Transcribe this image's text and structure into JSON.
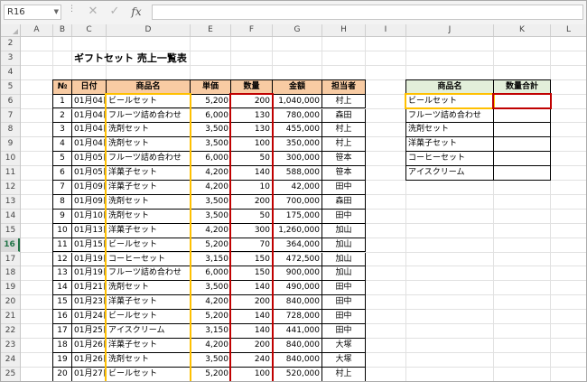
{
  "name_box": "R16",
  "formula_bar": {
    "fx_label": "fx",
    "cancel_icon": "✕",
    "enter_icon": "✓",
    "value": ""
  },
  "columns": [
    "A",
    "B",
    "C",
    "D",
    "E",
    "F",
    "G",
    "H",
    "I",
    "J",
    "K",
    "L"
  ],
  "rows": [
    2,
    3,
    4,
    5,
    6,
    7,
    8,
    9,
    10,
    11,
    12,
    13,
    14,
    15,
    16,
    17,
    18,
    19,
    20,
    21,
    22,
    23,
    24,
    25
  ],
  "active_row": 16,
  "title": "ギフトセット 売上一覧表",
  "sales_table": {
    "headers": [
      "№",
      "日付",
      "商品名",
      "単価",
      "数量",
      "金額",
      "担当者"
    ],
    "rows": [
      [
        "1",
        "01月04日",
        "ビールセット",
        "5,200",
        "200",
        "1,040,000",
        "村上"
      ],
      [
        "2",
        "01月04日",
        "フルーツ詰め合わせ",
        "6,000",
        "130",
        "780,000",
        "森田"
      ],
      [
        "3",
        "01月04日",
        "洗剤セット",
        "3,500",
        "130",
        "455,000",
        "村上"
      ],
      [
        "4",
        "01月04日",
        "洗剤セット",
        "3,500",
        "100",
        "350,000",
        "村上"
      ],
      [
        "5",
        "01月05日",
        "フルーツ詰め合わせ",
        "6,000",
        "50",
        "300,000",
        "笹本"
      ],
      [
        "6",
        "01月05日",
        "洋菓子セット",
        "4,200",
        "140",
        "588,000",
        "笹本"
      ],
      [
        "7",
        "01月09日",
        "洋菓子セット",
        "4,200",
        "10",
        "42,000",
        "田中"
      ],
      [
        "8",
        "01月09日",
        "洗剤セット",
        "3,500",
        "200",
        "700,000",
        "森田"
      ],
      [
        "9",
        "01月10日",
        "洗剤セット",
        "3,500",
        "50",
        "175,000",
        "田中"
      ],
      [
        "10",
        "01月13日",
        "洋菓子セット",
        "4,200",
        "300",
        "1,260,000",
        "加山"
      ],
      [
        "11",
        "01月15日",
        "ビールセット",
        "5,200",
        "70",
        "364,000",
        "加山"
      ],
      [
        "12",
        "01月19日",
        "コーヒーセット",
        "3,150",
        "150",
        "472,500",
        "加山"
      ],
      [
        "13",
        "01月19日",
        "フルーツ詰め合わせ",
        "6,000",
        "150",
        "900,000",
        "加山"
      ],
      [
        "14",
        "01月21日",
        "洗剤セット",
        "3,500",
        "140",
        "490,000",
        "田中"
      ],
      [
        "15",
        "01月23日",
        "洋菓子セット",
        "4,200",
        "200",
        "840,000",
        "田中"
      ],
      [
        "16",
        "01月24日",
        "ビールセット",
        "5,200",
        "140",
        "728,000",
        "田中"
      ],
      [
        "17",
        "01月25日",
        "アイスクリーム",
        "3,150",
        "140",
        "441,000",
        "田中"
      ],
      [
        "18",
        "01月26日",
        "洋菓子セット",
        "4,200",
        "200",
        "840,000",
        "大塚"
      ],
      [
        "19",
        "01月26日",
        "洗剤セット",
        "3,500",
        "240",
        "840,000",
        "大塚"
      ],
      [
        "20",
        "01月27日",
        "ビールセット",
        "5,200",
        "100",
        "520,000",
        "村上"
      ]
    ]
  },
  "summary_table": {
    "headers": [
      "商品名",
      "数量合計"
    ],
    "rows": [
      [
        "ビールセット",
        ""
      ],
      [
        "フルーツ詰め合わせ",
        ""
      ],
      [
        "洗剤セット",
        ""
      ],
      [
        "洋菓子セット",
        ""
      ],
      [
        "コーヒーセット",
        ""
      ],
      [
        "アイスクリーム",
        ""
      ]
    ]
  },
  "colors": {
    "header_orange": "#f8cba3",
    "header_green": "#e3efda",
    "highlight_orange": "#ffc000",
    "highlight_red": "#c00000",
    "active_green": "#217346"
  }
}
